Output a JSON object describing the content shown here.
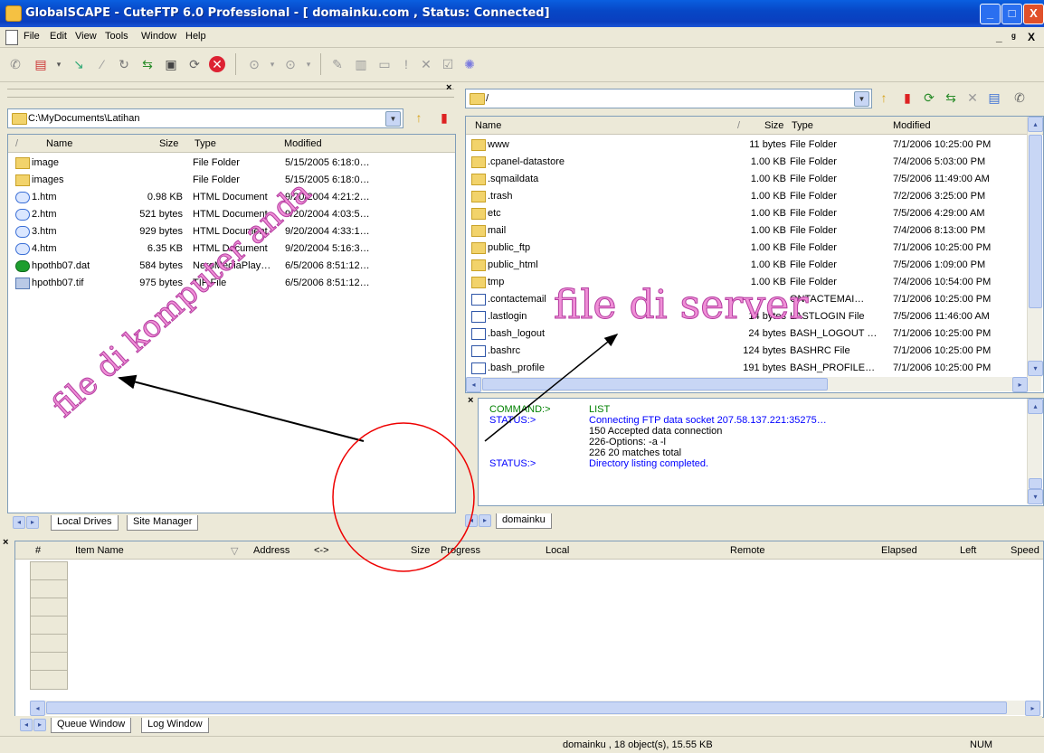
{
  "window": {
    "title": "GlobalSCAPE - CuteFTP 6.0 Professional - [ domainku.com , Status: Connected]",
    "controls": [
      "_",
      "□",
      "X"
    ]
  },
  "menu": {
    "items": [
      "File",
      "Edit",
      "View",
      "Tools",
      "Window",
      "Help"
    ],
    "mdi_controls": [
      "_",
      "ᵍ",
      "X"
    ]
  },
  "local": {
    "path": "C:\\MyDocuments\\Latihan",
    "columns": [
      "/",
      "Name",
      "Size",
      "Type",
      "Modified"
    ],
    "files": [
      {
        "icon": "folder",
        "name": "image",
        "size": "",
        "type": "File Folder",
        "modified": "5/15/2005 6:18:0…"
      },
      {
        "icon": "folder",
        "name": "images",
        "size": "",
        "type": "File Folder",
        "modified": "5/15/2005 6:18:0…"
      },
      {
        "icon": "html",
        "name": "1.htm",
        "size": "0.98 KB",
        "type": "HTML Document",
        "modified": "9/20/2004 4:21:2…"
      },
      {
        "icon": "html",
        "name": "2.htm",
        "size": "521 bytes",
        "type": "HTML Document",
        "modified": "9/20/2004 4:03:5…"
      },
      {
        "icon": "html",
        "name": "3.htm",
        "size": "929 bytes",
        "type": "HTML Document",
        "modified": "9/20/2004 4:33:1…"
      },
      {
        "icon": "html",
        "name": "4.htm",
        "size": "6.35 KB",
        "type": "HTML Document",
        "modified": "9/20/2004 5:16:3…"
      },
      {
        "icon": "dat",
        "name": "hpothb07.dat",
        "size": "584 bytes",
        "type": "NeroMediaPlay…",
        "modified": "6/5/2006 8:51:12…"
      },
      {
        "icon": "tif",
        "name": "hpothb07.tif",
        "size": "975 bytes",
        "type": "TIF File",
        "modified": "6/5/2006 8:51:12…"
      }
    ],
    "tabs": [
      "Local Drives",
      "Site Manager"
    ],
    "annotation": "file di komputer anda"
  },
  "remote": {
    "path": "/",
    "columns": [
      "Name",
      "/",
      "Size",
      "Type",
      "Modified"
    ],
    "files": [
      {
        "icon": "folder",
        "name": "www",
        "size": "11 bytes",
        "type": "File Folder",
        "modified": "7/1/2006 10:25:00 PM"
      },
      {
        "icon": "folder",
        "name": ".cpanel-datastore",
        "size": "1.00 KB",
        "type": "File Folder",
        "modified": "7/4/2006 5:03:00 PM"
      },
      {
        "icon": "folder",
        "name": ".sqmaildata",
        "size": "1.00 KB",
        "type": "File Folder",
        "modified": "7/5/2006 11:49:00 AM"
      },
      {
        "icon": "folder",
        "name": ".trash",
        "size": "1.00 KB",
        "type": "File Folder",
        "modified": "7/2/2006 3:25:00 PM"
      },
      {
        "icon": "folder",
        "name": "etc",
        "size": "1.00 KB",
        "type": "File Folder",
        "modified": "7/5/2006 4:29:00 AM"
      },
      {
        "icon": "folder",
        "name": "mail",
        "size": "1.00 KB",
        "type": "File Folder",
        "modified": "7/4/2006 8:13:00 PM"
      },
      {
        "icon": "folder",
        "name": "public_ftp",
        "size": "1.00 KB",
        "type": "File Folder",
        "modified": "7/1/2006 10:25:00 PM"
      },
      {
        "icon": "folder",
        "name": "public_html",
        "size": "1.00 KB",
        "type": "File Folder",
        "modified": "7/5/2006 1:09:00 PM"
      },
      {
        "icon": "folder",
        "name": "tmp",
        "size": "1.00 KB",
        "type": "File Folder",
        "modified": "7/4/2006 10:54:00 PM"
      },
      {
        "icon": "file",
        "name": ".contactemail",
        "size": "",
        "type": "ONTACTEMAI…",
        "modified": "7/1/2006 10:25:00 PM"
      },
      {
        "icon": "file",
        "name": ".lastlogin",
        "size": "14 bytes",
        "type": "LASTLOGIN File",
        "modified": "7/5/2006 11:46:00 AM"
      },
      {
        "icon": "file",
        "name": ".bash_logout",
        "size": "24 bytes",
        "type": "BASH_LOGOUT …",
        "modified": "7/1/2006 10:25:00 PM"
      },
      {
        "icon": "file",
        "name": ".bashrc",
        "size": "124 bytes",
        "type": "BASHRC File",
        "modified": "7/1/2006 10:25:00 PM"
      },
      {
        "icon": "file",
        "name": ".bash_profile",
        "size": "191 bytes",
        "type": "BASH_PROFILE…",
        "modified": "7/1/2006 10:25:00 PM"
      }
    ],
    "annotation": "file di server",
    "tab": "domainku"
  },
  "log": {
    "lines": [
      {
        "label": "COMMAND:>",
        "text": "LIST",
        "color": "#008000"
      },
      {
        "label": "STATUS:>",
        "text": "Connecting FTP data socket 207.58.137.221:35275…",
        "color": "#0000ff"
      },
      {
        "label": "",
        "text": "150 Accepted data connection",
        "color": "#000000"
      },
      {
        "label": "",
        "text": "226-Options: -a -l",
        "color": "#000000"
      },
      {
        "label": "",
        "text": "226 20 matches total",
        "color": "#000000"
      },
      {
        "label": "STATUS:>",
        "text": "Directory listing completed.",
        "color": "#0000ff"
      }
    ]
  },
  "queue": {
    "columns": [
      "#",
      "Item Name",
      "Address",
      "<->",
      "Size",
      "Progress",
      "Local",
      "Remote",
      "Elapsed",
      "Left",
      "Speed"
    ],
    "sort_marker": "▽",
    "tabs": [
      "Queue Window",
      "Log Window"
    ]
  },
  "statusbar": {
    "text": "domainku , 18 object(s), 15.55 KB",
    "num": "NUM"
  }
}
